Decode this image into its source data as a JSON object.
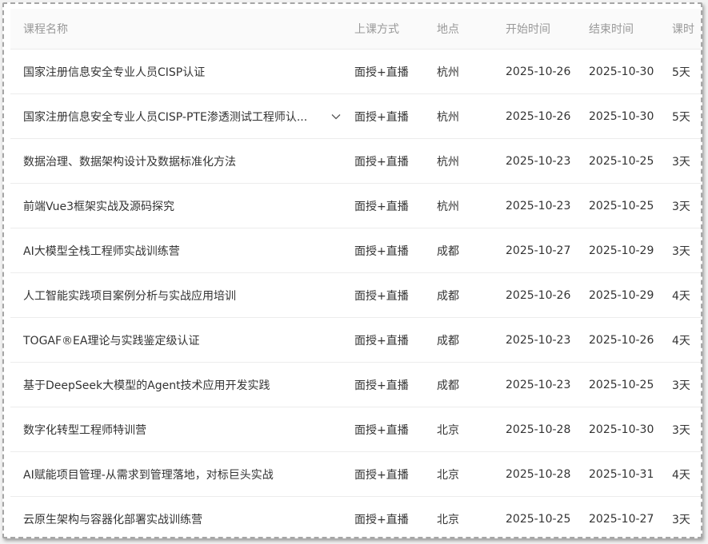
{
  "headers": {
    "name": "课程名称",
    "mode": "上课方式",
    "location": "地点",
    "start": "开始时间",
    "end": "结束时间",
    "hours": "课时"
  },
  "rows": [
    {
      "name": "国家注册信息安全专业人员CISP认证",
      "mode": "面授+直播",
      "location": "杭州",
      "start": "2025-10-26",
      "end": "2025-10-30",
      "hours": "5天"
    },
    {
      "name": "国家注册信息安全专业人员CISP-PTE渗透测试工程师认...",
      "mode": "面授+直播",
      "location": "杭州",
      "start": "2025-10-26",
      "end": "2025-10-30",
      "hours": "5天",
      "expand_icon": "chevron-down-icon"
    },
    {
      "name": "数据治理、数据架构设计及数据标准化方法",
      "mode": "面授+直播",
      "location": "杭州",
      "start": "2025-10-23",
      "end": "2025-10-25",
      "hours": "3天"
    },
    {
      "name": "前端Vue3框架实战及源码探究",
      "mode": "面授+直播",
      "location": "杭州",
      "start": "2025-10-23",
      "end": "2025-10-25",
      "hours": "3天"
    },
    {
      "name": "AI大模型全栈工程师实战训练营",
      "mode": "面授+直播",
      "location": "成都",
      "start": "2025-10-27",
      "end": "2025-10-29",
      "hours": "3天"
    },
    {
      "name": "人工智能实践项目案例分析与实战应用培训",
      "mode": "面授+直播",
      "location": "成都",
      "start": "2025-10-26",
      "end": "2025-10-29",
      "hours": "4天"
    },
    {
      "name": "TOGAF®EA理论与实践鉴定级认证",
      "mode": "面授+直播",
      "location": "成都",
      "start": "2025-10-23",
      "end": "2025-10-26",
      "hours": "4天"
    },
    {
      "name": "基于DeepSeek大模型的Agent技术应用开发实践",
      "mode": "面授+直播",
      "location": "成都",
      "start": "2025-10-23",
      "end": "2025-10-25",
      "hours": "3天"
    },
    {
      "name": "数字化转型工程师特训营",
      "mode": "面授+直播",
      "location": "北京",
      "start": "2025-10-28",
      "end": "2025-10-30",
      "hours": "3天"
    },
    {
      "name": "AI赋能项目管理-从需求到管理落地，对标巨头实战",
      "mode": "面授+直播",
      "location": "北京",
      "start": "2025-10-28",
      "end": "2025-10-31",
      "hours": "4天"
    },
    {
      "name": "云原生架构与容器化部署实战训练营",
      "mode": "面授+直播",
      "location": "北京",
      "start": "2025-10-25",
      "end": "2025-10-27",
      "hours": "3天"
    }
  ]
}
